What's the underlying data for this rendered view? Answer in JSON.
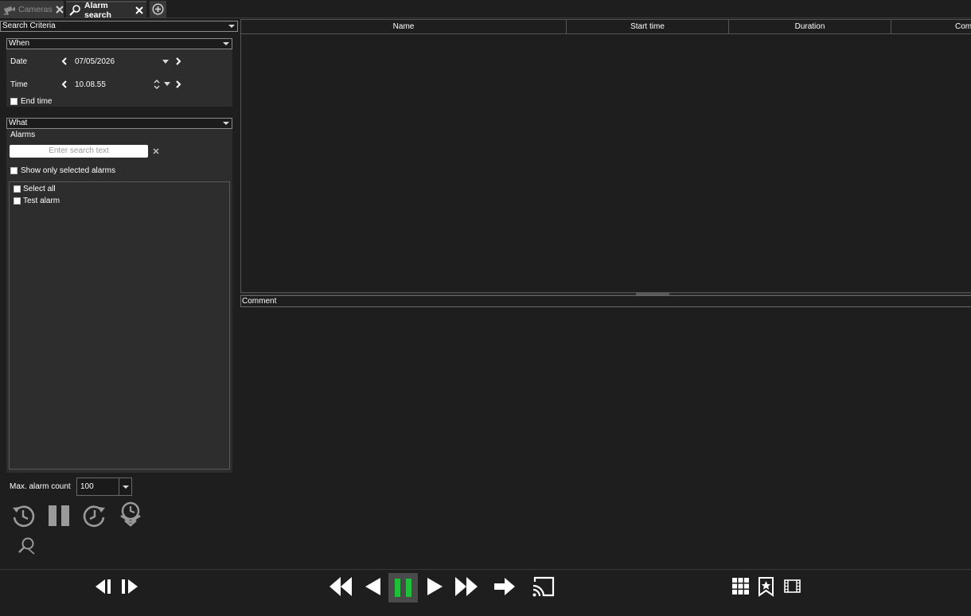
{
  "tabs": [
    {
      "label": "Cameras",
      "icon": "camera-icon",
      "active": false
    },
    {
      "label": "Alarm search",
      "icon": "alarm-search-icon",
      "active": true
    }
  ],
  "add_tab_icon": "add-tab-icon",
  "search_criteria": {
    "header": "Search Criteria",
    "when": {
      "header": "When",
      "date_label": "Date",
      "date_value": "07/05/2026",
      "time_label": "Time",
      "time_value": "10.08.55",
      "end_time_label": "End time",
      "end_time_checked": false
    },
    "what": {
      "header": "What",
      "alarms_label": "Alarms",
      "search_placeholder": "Enter search text",
      "show_only_selected_label": "Show only selected alarms",
      "list": [
        {
          "label": "Select all",
          "checked": false
        },
        {
          "label": "Test alarm",
          "checked": false
        }
      ]
    },
    "max_alarm_count_label": "Max. alarm count",
    "max_alarm_count_value": "100"
  },
  "table": {
    "columns": [
      "Name",
      "Start time",
      "Duration",
      "Com"
    ],
    "rows": []
  },
  "comment": {
    "label": "Comment"
  },
  "colors": {
    "background": "#1e1e1e",
    "panel": "#2d2d2d",
    "playing_green": "#1fbf3a",
    "icon_gray": "#9a9a9a"
  }
}
